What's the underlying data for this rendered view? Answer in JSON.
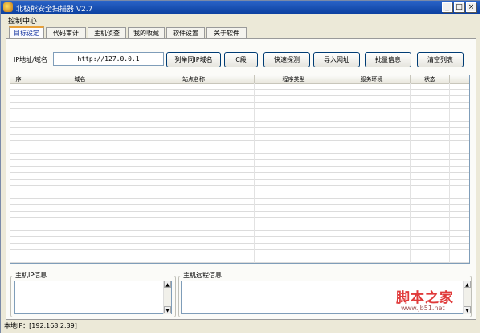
{
  "window": {
    "title": "北极熊安全扫描器 V2.7",
    "controls": {
      "minimize": "_",
      "maximize": "□",
      "close": "×"
    }
  },
  "menu": {
    "items": [
      "控制中心"
    ]
  },
  "tabs": [
    "目标设定",
    "代码审计",
    "主机侦查",
    "我的收藏",
    "软件设置",
    "关于软件"
  ],
  "target": {
    "label": "IP地址/域名",
    "value": "http://127.0.0.1"
  },
  "buttons": [
    "列举同IP域名",
    "C段",
    "快速探测",
    "导入网址",
    "批量信息",
    "清空列表"
  ],
  "list": {
    "columns": [
      "序",
      "域名",
      "站点名称",
      "程序类型",
      "服务环境",
      "状态"
    ]
  },
  "panels": {
    "host_ip": "主机IP信息",
    "host_remote": "主机远程信息"
  },
  "scroll_arrows": {
    "up": "▲",
    "down": "▼"
  },
  "statusbar": {
    "text": "本地IP：[192.168.2.39]"
  },
  "watermark": {
    "text": "脚本之家",
    "url": "www.jb51.net"
  }
}
